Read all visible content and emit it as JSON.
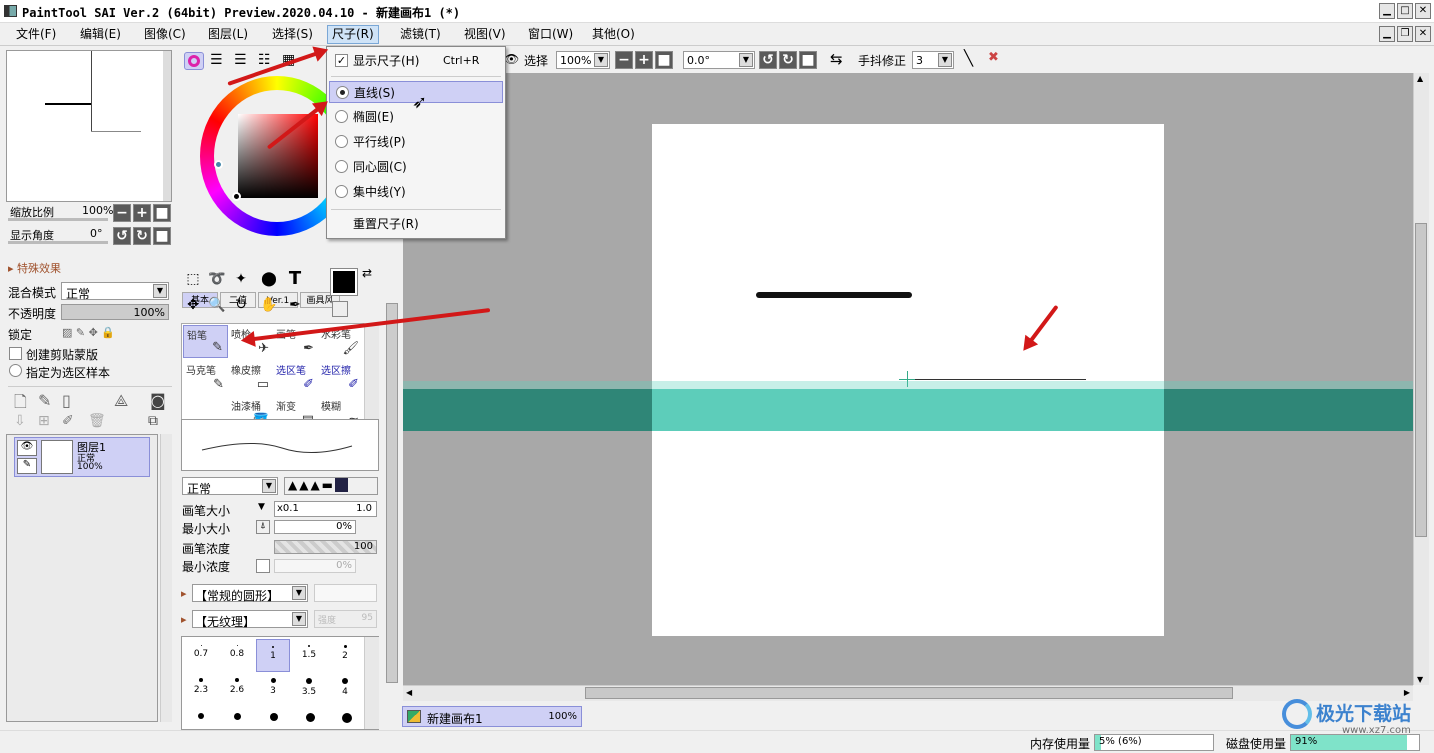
{
  "window": {
    "title": "PaintTool SAI Ver.2 (64bit) Preview.2020.04.10 - 新建画布1 (*)"
  },
  "menubar": {
    "items": [
      "文件(F)",
      "编辑(E)",
      "图像(C)",
      "图层(L)",
      "选择(S)",
      "尺子(R)",
      "滤镜(T)",
      "视图(V)",
      "窗口(W)",
      "其他(O)"
    ]
  },
  "ruler_menu": {
    "show_ruler": "显示尺子(H)",
    "show_ruler_shortcut": "Ctrl+R",
    "items": [
      "直线(S)",
      "椭圆(E)",
      "平行线(P)",
      "同心圆(C)",
      "集中线(Y)"
    ],
    "selected": "直线(S)",
    "reset": "重置尺子(R)"
  },
  "toolbar": {
    "select_label": "选择",
    "zoom_value": "100%",
    "angle_value": "0.0°",
    "stabilizer_label": "手抖修正",
    "stabilizer_value": "3"
  },
  "navigator": {
    "zoom_label": "缩放比例",
    "zoom_value": "100%",
    "angle_label": "显示角度",
    "angle_value": "0°"
  },
  "layer_panel": {
    "effects_label": "特殊效果",
    "blend_label": "混合模式",
    "blend_value": "正常",
    "opacity_label": "不透明度",
    "opacity_value": "100%",
    "lock_label": "锁定",
    "clip_label": "创建剪贴蒙版",
    "sample_label": "指定为选区样本",
    "layer": {
      "name": "图层1",
      "mode": "正常",
      "opacity": "100%"
    }
  },
  "tool_tabs": [
    "基本",
    "二值",
    "Ver.1",
    "画具风"
  ],
  "brushes": [
    {
      "name": "铅笔",
      "selected": true,
      "blue": false
    },
    {
      "name": "喷枪",
      "selected": false,
      "blue": false
    },
    {
      "name": "画笔",
      "selected": false,
      "blue": false
    },
    {
      "name": "水彩笔",
      "selected": false,
      "blue": false
    },
    {
      "name": "马克笔",
      "selected": false,
      "blue": false
    },
    {
      "name": "橡皮擦",
      "selected": false,
      "blue": false
    },
    {
      "name": "选区笔",
      "selected": false,
      "blue": true
    },
    {
      "name": "选区擦",
      "selected": false,
      "blue": true
    },
    {
      "name": "",
      "selected": false,
      "blue": false
    },
    {
      "name": "油漆桶",
      "selected": false,
      "blue": false
    },
    {
      "name": "渐变",
      "selected": false,
      "blue": false
    },
    {
      "name": "模糊",
      "selected": false,
      "blue": false
    }
  ],
  "brush_settings": {
    "mode_value": "正常",
    "size_label": "画笔大小",
    "size_mult": "x0.1",
    "size_value": "1.0",
    "min_size_label": "最小大小",
    "min_size_value": "0%",
    "density_label": "画笔浓度",
    "density_value": "100",
    "min_density_label": "最小浓度",
    "min_density_value": "0%",
    "shape_value": "【常规的圆形】",
    "texture_value": "【无纹理】",
    "texture_strength_label": "强度",
    "texture_strength_value": "95"
  },
  "brush_sizes": [
    "0.7",
    "0.8",
    "1",
    "1.5",
    "2",
    "2.3",
    "2.6",
    "3",
    "3.5",
    "4"
  ],
  "brush_size_selected": "1",
  "canvas_tab": {
    "name": "新建画布1",
    "zoom": "100%"
  },
  "status": {
    "memory_label": "内存使用量",
    "memory_value": "5% (6%)",
    "memory_fill": 0.05,
    "disk_label": "磁盘使用量",
    "disk_value": "91%",
    "disk_fill": 0.91
  },
  "watermark": {
    "text": "极光下载站",
    "url": "www.xz7.com"
  }
}
